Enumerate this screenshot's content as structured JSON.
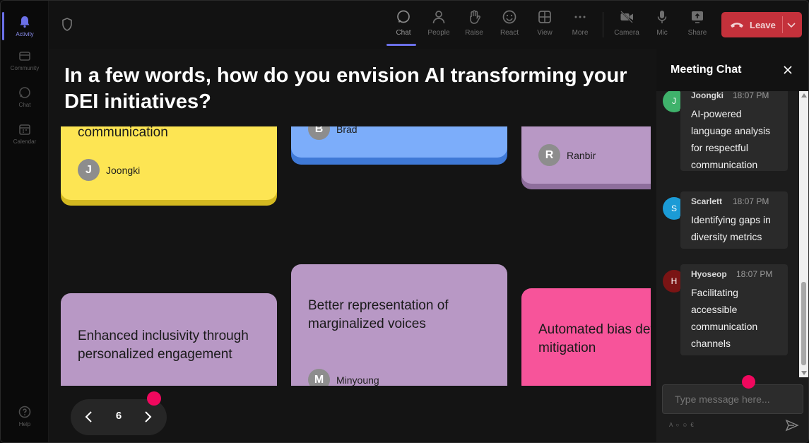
{
  "rail": {
    "items": [
      {
        "label": "Activity",
        "active": true
      },
      {
        "label": "Community"
      },
      {
        "label": "Chat"
      },
      {
        "label": "Calendar"
      }
    ],
    "help": "Help"
  },
  "topbar": {
    "chat": "Chat",
    "people": "People",
    "raise": "Raise",
    "react": "React",
    "view": "View",
    "more": "More",
    "camera": "Camera",
    "mic": "Mic",
    "share": "Share",
    "leave": "Leave"
  },
  "stage": {
    "question": "In a few words, how do you envision AI transforming your DEI initiatives?",
    "cards": [
      {
        "text": "communication",
        "author": "Joongki",
        "initial": "J",
        "color": "#fde553",
        "shade": "#d4b920"
      },
      {
        "text": "",
        "author": "Brad",
        "initial": "B",
        "color": "#7cadfa",
        "shade": "#3f79d6"
      },
      {
        "text": "",
        "author": "Ranbir",
        "initial": "R",
        "color": "#b898c5",
        "shade": "#8e6e9c"
      },
      {
        "text": "Enhanced inclusivity through personalized engagement",
        "author": "",
        "initial": "",
        "color": "#b898c5"
      },
      {
        "text": "Better representation of marginalized voices",
        "author": "Minyoung",
        "initial": "M",
        "color": "#b898c5"
      },
      {
        "text": "Automated bias detection and mitigation",
        "author": "",
        "initial": "",
        "color": "#f7549a"
      }
    ],
    "page": "6"
  },
  "chat": {
    "title": "Meeting Chat",
    "messages": [
      {
        "name": "Joongki",
        "time": "18:07 PM",
        "initial": "J",
        "avatar_color": "#3fb26b",
        "text": "AI-powered language analysis for respectful communication"
      },
      {
        "name": "Scarlett",
        "time": "18:07 PM",
        "initial": "S",
        "avatar_color": "#1b9bd6",
        "text": "Identifying gaps in diversity metrics"
      },
      {
        "name": "Hyoseop",
        "time": "18:07 PM",
        "initial": "H",
        "avatar_color": "#7a1414",
        "text": "Facilitating accessible communication channels"
      }
    ],
    "input_placeholder": "Type message here..."
  },
  "colors": {
    "accent": "#6b70e8",
    "leave": "#c4313b",
    "pink_dot": "#f0085e"
  }
}
